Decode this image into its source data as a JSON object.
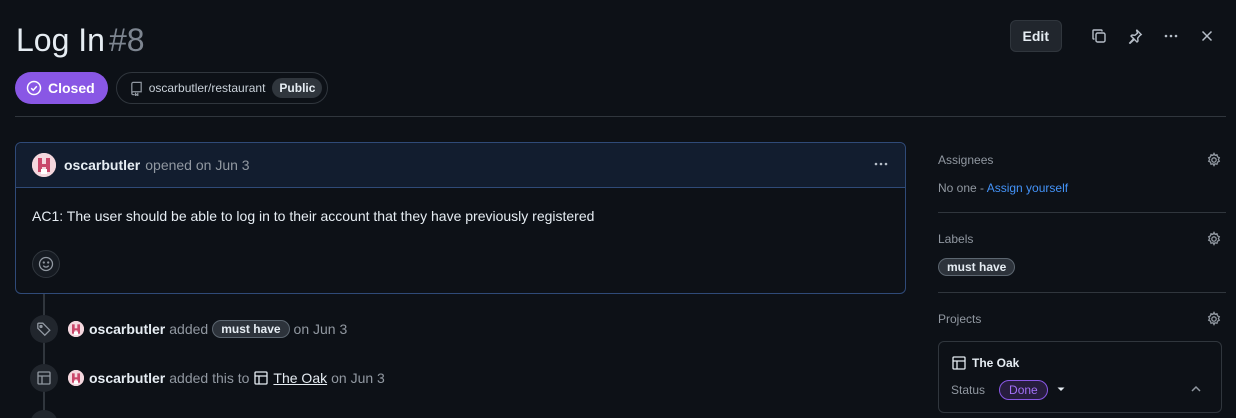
{
  "issue": {
    "title": "Log In",
    "number": "#8",
    "state": "Closed",
    "repo": "oscarbutler/restaurant",
    "visibility": "Public"
  },
  "actions": {
    "edit_label": "Edit",
    "icons": [
      "copy-icon",
      "pin-icon",
      "kebab-icon",
      "close-icon"
    ]
  },
  "comment": {
    "author": "oscarbutler",
    "meta": "opened on Jun 3",
    "body": "AC1: The user should be able to log in to their account that they have previously registered"
  },
  "timeline": [
    {
      "icon": "tag-icon",
      "author": "oscarbutler",
      "action": "added",
      "label": "must have",
      "date": "on Jun 3"
    },
    {
      "icon": "table-icon",
      "author": "oscarbutler",
      "action": "added this to",
      "project": "The Oak",
      "date": "on Jun 3"
    }
  ],
  "sidebar": {
    "assignees": {
      "title": "Assignees",
      "value": "No one - ",
      "link": "Assign yourself"
    },
    "labels": {
      "title": "Labels",
      "items": [
        "must have"
      ]
    },
    "projects": {
      "title": "Projects",
      "project_name": "The Oak",
      "status_label": "Status",
      "status_value": "Done"
    }
  },
  "colors": {
    "background": "#0d1117",
    "closed_purple": "#8957e5",
    "link_blue": "#4493f8",
    "border": "#30363d"
  }
}
